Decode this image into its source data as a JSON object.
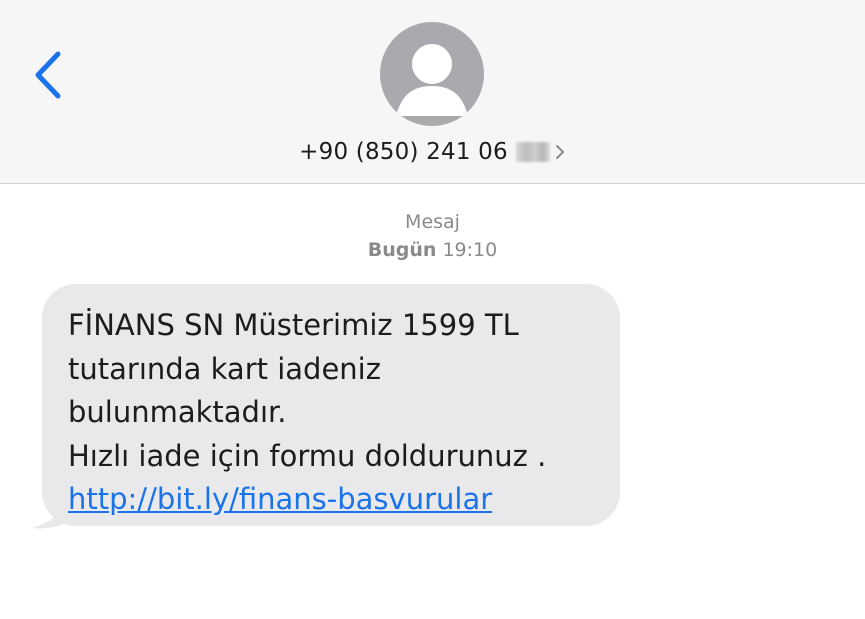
{
  "header": {
    "back_icon": "chevron-left-icon",
    "avatar_icon": "person-silhouette-icon",
    "contact_number": "+90 (850) 241 06",
    "disclosure_icon": "chevron-right-icon"
  },
  "conversation": {
    "service_label": "Mesaj",
    "timestamp_day": "Bugün",
    "timestamp_time": "19:10"
  },
  "message": {
    "lines": [
      "FİNANS SN Müsterimiz 1599 TL",
      "tutarında kart iadeniz",
      "bulunmaktadır.",
      "Hızlı iade için formu doldurunuz ."
    ],
    "link": "http://bit.ly/finans-basvurular"
  },
  "colors": {
    "accent": "#1a73e8",
    "header_bg": "#f6f6f6",
    "bubble_bg": "#e9e9eb",
    "avatar_bg": "#a9a9ae"
  }
}
